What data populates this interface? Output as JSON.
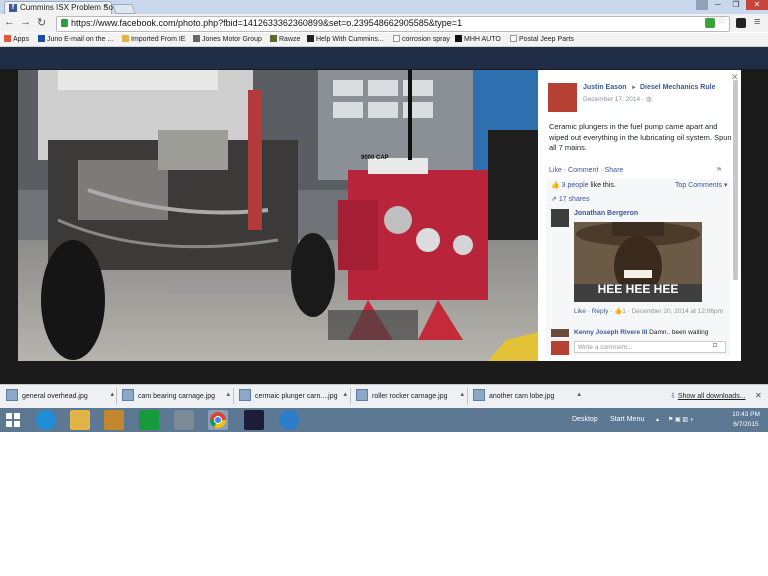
{
  "browser": {
    "tab_title": "Cummins ISX Problem So",
    "tab_close": "×",
    "url": "https://www.facebook.com/photo.php?fbid=1412633362360899&set=o.239548662905585&type=1",
    "window_controls": [
      "─",
      "❐",
      "✕"
    ]
  },
  "bookmarks": [
    {
      "label": "Apps",
      "icon": "apps-grid-icon"
    },
    {
      "label": "Juno E-mail on the ...",
      "icon": "juno-icon"
    },
    {
      "label": "Imported From IE",
      "icon": "folder-icon"
    },
    {
      "label": "Jones Motor Group",
      "icon": "jones-icon"
    },
    {
      "label": "Rawze",
      "icon": "rawze-icon"
    },
    {
      "label": "Help With Cummins...",
      "icon": "cummins-icon"
    },
    {
      "label": "corrosion spray",
      "icon": "amazon-icon"
    },
    {
      "label": "MHH AUTO",
      "icon": "mhh-icon"
    },
    {
      "label": "Postal Jeep Parts",
      "icon": "page-icon"
    }
  ],
  "post": {
    "author": "Justin Eason",
    "arrow": "►",
    "group": "Diesel Mechanics Rule",
    "date": "December 17, 2014 · ",
    "text": "Ceramic plungers in the fuel pump came apart and wiped out everything in the lubricating oil system. Spun all 7 mains.",
    "actions": "Like · Comment · Share",
    "likes_count": "3 people",
    "likes_suffix": " like this.",
    "top_comments": "Top Comments ▾",
    "shares": "17 shares",
    "engine_label": "9000 CAP"
  },
  "comments": [
    {
      "author": "Jonathan Bergeron",
      "gif_caption": "HEE HEE HEE",
      "actions": "Like · Reply · ",
      "like_count": "1",
      "date": " · December 20, 2014 at 12:06pm"
    },
    {
      "author": "Kenny Joseph Rivere III",
      "text": "Damn.. been waiting"
    }
  ],
  "comment_placeholder": "Write a comment...",
  "downloads": [
    {
      "name": "general overhead.jpg"
    },
    {
      "name": "cam bearing carnage.jpg"
    },
    {
      "name": "cermaic plunger carn....jpg"
    },
    {
      "name": "roller rocker carnage.jpg"
    },
    {
      "name": "another cam lobe.jpg"
    }
  ],
  "show_all_downloads": "Show all downloads...",
  "taskbar": {
    "desktop": "Desktop",
    "start_menu": "Start Menu",
    "time": "10:43 PM",
    "date": "6/7/2015"
  },
  "colors": {
    "facebook_blue": "#3b5998",
    "taskbar": "#5d7892"
  }
}
